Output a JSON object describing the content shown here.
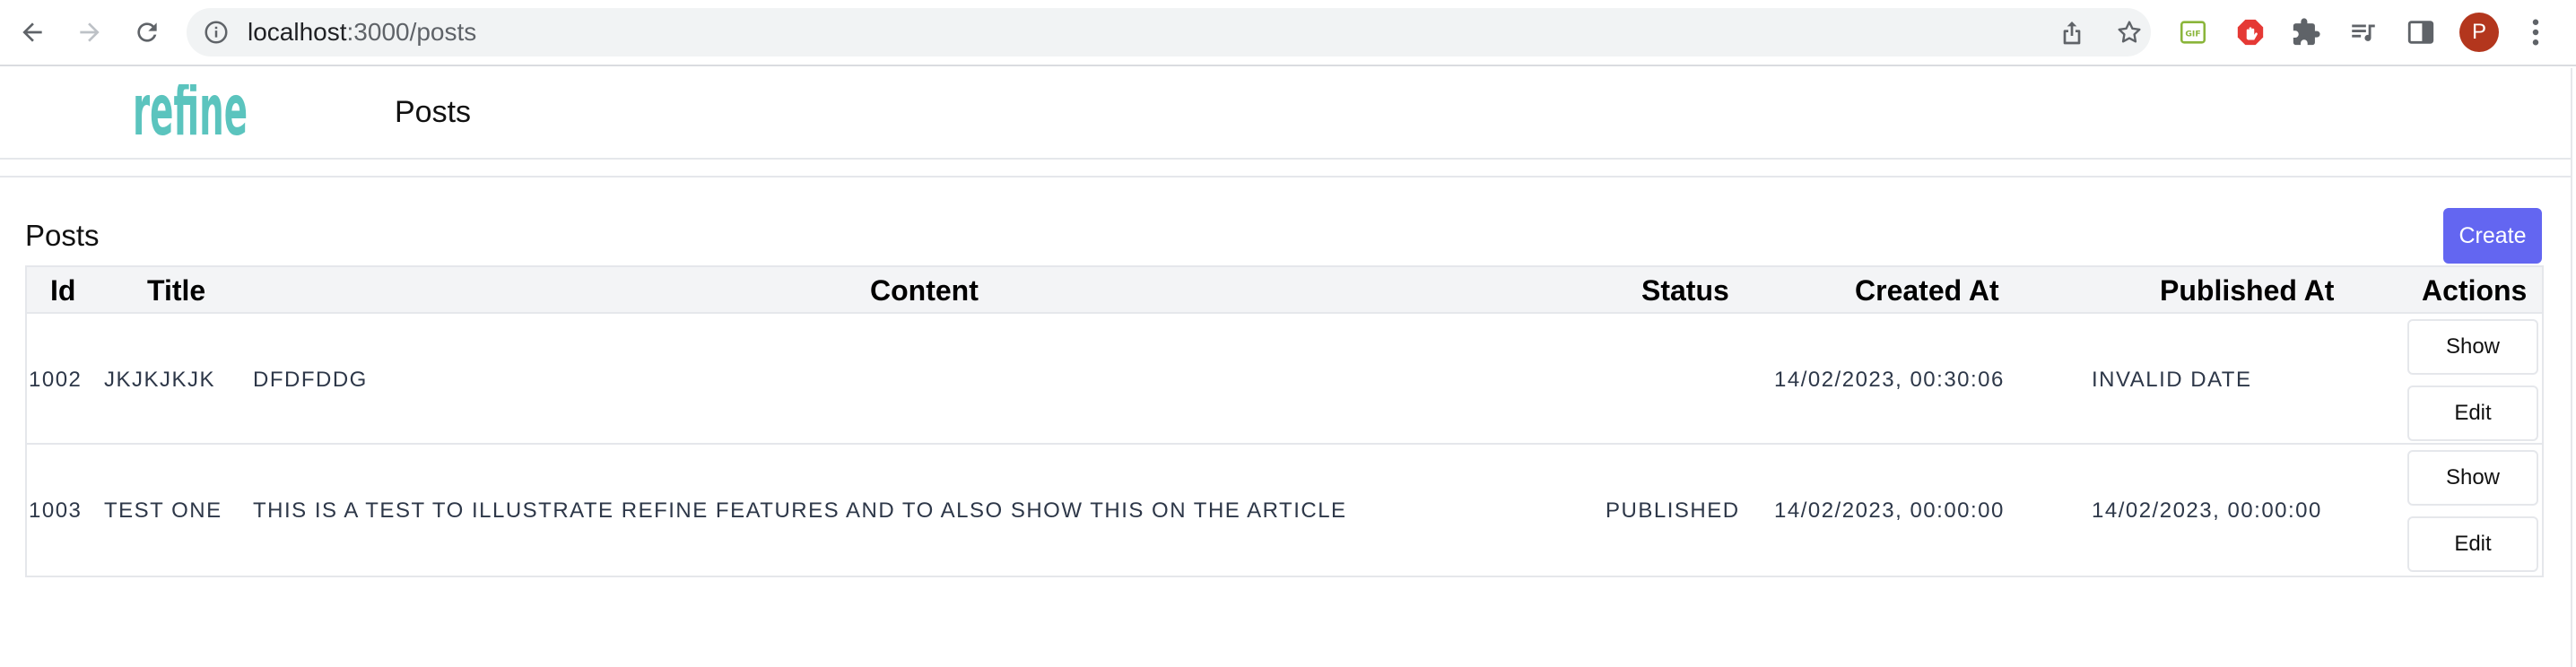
{
  "browser": {
    "url_host": "localhost",
    "url_path": ":3000/posts",
    "profile_initial": "P",
    "icons": [
      "back-icon",
      "forward-icon",
      "reload-icon",
      "info-icon",
      "share-icon",
      "star-icon",
      "gif-extension-icon",
      "adblock-extension-icon",
      "puzzle-extension-icon",
      "media-icon",
      "side-panel-icon",
      "more-vert-icon"
    ],
    "colors": {
      "adblock": "#e53935",
      "avatar": "#b3361d",
      "gif_ext": "#8ab53a"
    }
  },
  "header": {
    "logo_text": "refine",
    "title": "Posts",
    "logo_colors": {
      "teal": "#5bc4be",
      "blue": "#3b82f6"
    }
  },
  "page": {
    "title": "Posts",
    "create_label": "Create",
    "accent": "#6366f1"
  },
  "table": {
    "columns": [
      "Id",
      "Title",
      "Content",
      "Status",
      "Created At",
      "Published At",
      "Actions"
    ],
    "rows": [
      {
        "id": "1002",
        "title": "jkjkjkjk",
        "content": "dfdfddg",
        "status": "",
        "created_at": "14/02/2023, 00:30:06",
        "published_at": "Invalid Date",
        "show_label": "Show",
        "edit_label": "Edit"
      },
      {
        "id": "1003",
        "title": "test one",
        "content": "this is a test to illustrate refine features and to also show this on the article",
        "status": "published",
        "created_at": "14/02/2023, 00:00:00",
        "published_at": "14/02/2023, 00:00:00",
        "show_label": "Show",
        "edit_label": "Edit"
      }
    ]
  }
}
